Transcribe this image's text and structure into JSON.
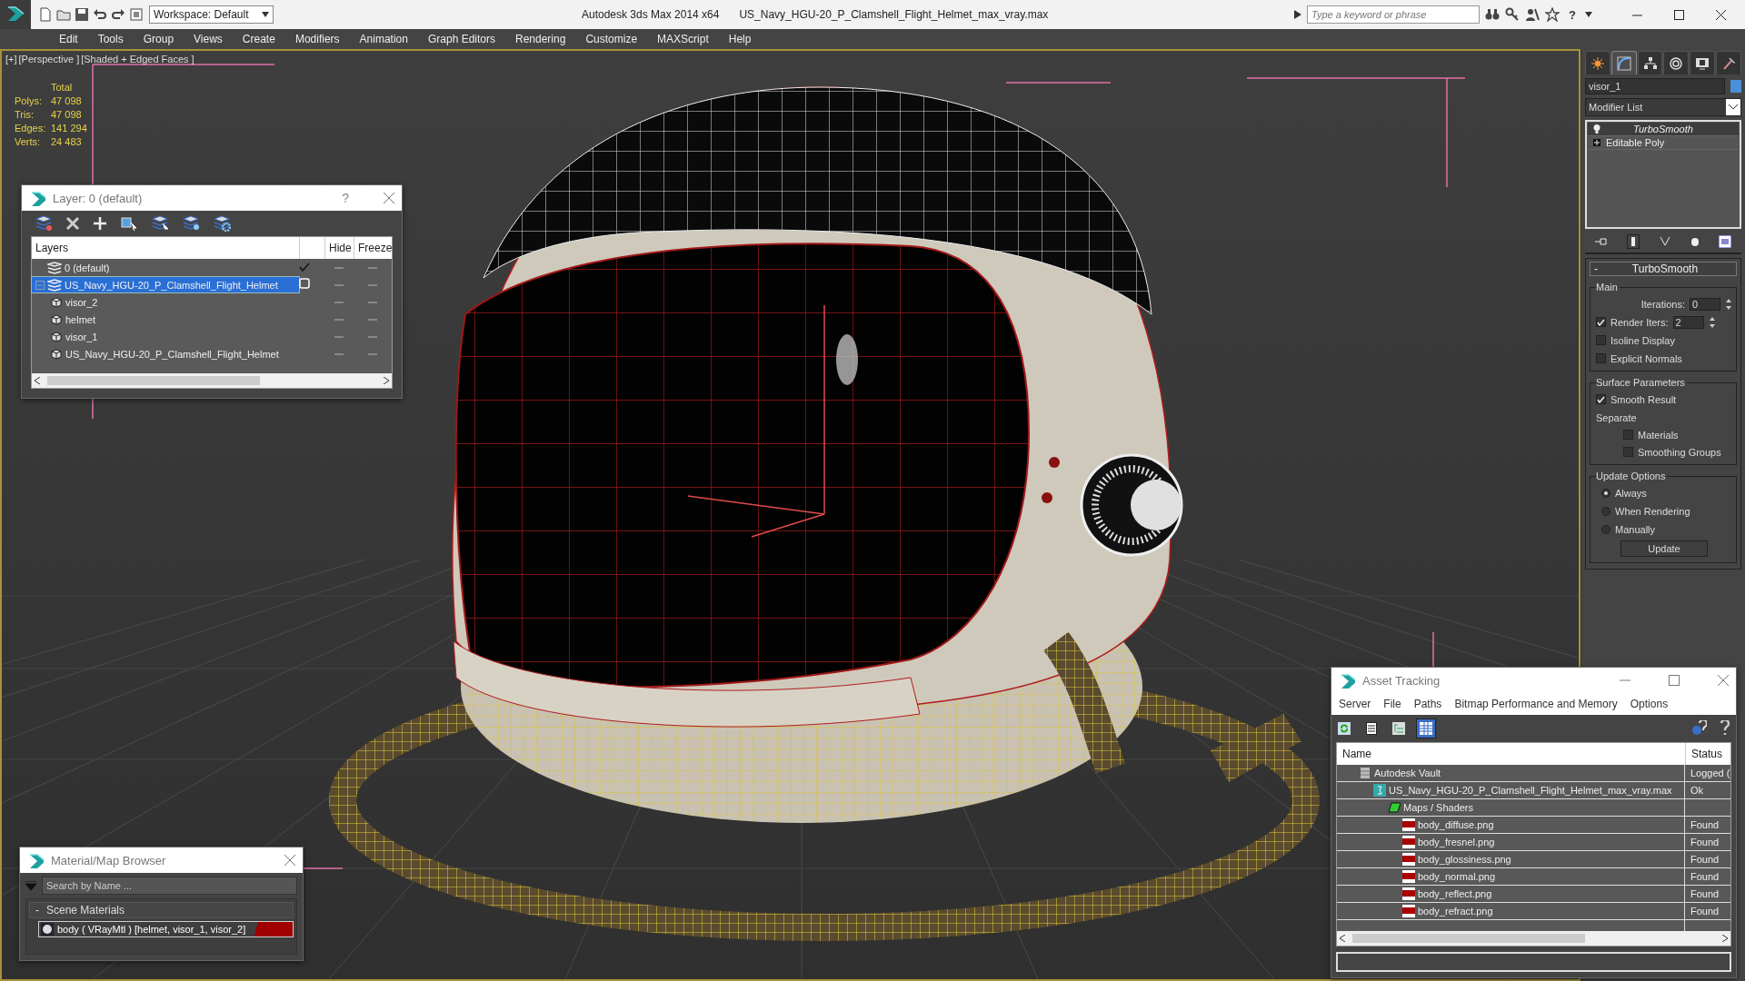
{
  "title_bar": {
    "workspace": "Workspace: Default",
    "app_title": "Autodesk 3ds Max  2014 x64",
    "file_name": "US_Navy_HGU-20_P_Clamshell_Flight_Helmet_max_vray.max",
    "search": {
      "placeholder": "Type a keyword or phrase"
    },
    "help": "?"
  },
  "menu": [
    "Edit",
    "Tools",
    "Group",
    "Views",
    "Create",
    "Modifiers",
    "Animation",
    "Graph Editors",
    "Rendering",
    "Customize",
    "MAXScript",
    "Help"
  ],
  "viewport": {
    "label": [
      "[+]",
      "[Perspective ]",
      "[Shaded + Edged Faces ]"
    ],
    "stats": {
      "header": "Total",
      "rows": [
        {
          "label": "Polys:",
          "value": "47 098"
        },
        {
          "label": "Tris:",
          "value": "47 098"
        },
        {
          "label": "Edges:",
          "value": "141 294"
        },
        {
          "label": "Verts:",
          "value": "24 483"
        }
      ]
    }
  },
  "layer_dialog": {
    "title": "Layer: 0 (default)",
    "help": "?",
    "columns": [
      "Layers",
      "Hide",
      "Freeze"
    ],
    "rows": [
      {
        "name": "0 (default)",
        "kind": "layer",
        "selected": false,
        "current": true
      },
      {
        "name": "US_Navy_HGU-20_P_Clamshell_Flight_Helmet",
        "kind": "layer",
        "selected": true,
        "current": false,
        "expanded": true,
        "children": [
          {
            "name": "visor_2",
            "kind": "object",
            "selected": false
          },
          {
            "name": "helmet",
            "kind": "object",
            "selected": false
          },
          {
            "name": "visor_1",
            "kind": "object",
            "selected": false
          },
          {
            "name": "US_Navy_HGU-20_P_Clamshell_Flight_Helmet",
            "kind": "object",
            "selected": false
          }
        ]
      }
    ]
  },
  "material_browser": {
    "title": "Material/Map Browser",
    "search": {
      "placeholder": "Search by Name ..."
    },
    "group": {
      "toggle": "-",
      "label": "Scene Materials"
    },
    "items": [
      {
        "name": "body  ( VRayMtl ) [helmet, visor_1, visor_2]",
        "selected": true
      }
    ]
  },
  "command_panel": {
    "tabs": [
      {
        "selected": false
      },
      {
        "selected": true
      },
      {
        "selected": false
      },
      {
        "selected": false
      },
      {
        "selected": false
      },
      {
        "selected": false
      }
    ],
    "object_name": "visor_1",
    "modifier_list": "Modifier List",
    "stack": [
      {
        "name": "TurboSmooth",
        "kind": "modifier",
        "selected": true
      },
      {
        "name": "Editable Poly",
        "kind": "base",
        "selected": false
      }
    ],
    "rollout": {
      "toggle": "-",
      "title": "TurboSmooth",
      "groups": [
        {
          "title": "Main",
          "controls": [
            {
              "kind": "spinner",
              "label": "Iterations:",
              "value": "0"
            },
            {
              "kind": "check_spinner",
              "label": "Render Iters:",
              "value": "2",
              "checked": true
            },
            {
              "kind": "checkbox",
              "label": "Isoline Display",
              "checked": false
            },
            {
              "kind": "checkbox",
              "label": "Explicit Normals",
              "checked": false
            }
          ]
        },
        {
          "title": "Surface Parameters",
          "controls": [
            {
              "kind": "checkbox",
              "label": "Smooth Result",
              "checked": true
            },
            {
              "kind": "label",
              "label": "Separate",
              "children": [
                {
                  "kind": "checkbox",
                  "label": "Materials",
                  "checked": false
                },
                {
                  "kind": "checkbox",
                  "label": "Smoothing Groups",
                  "checked": false
                }
              ]
            }
          ]
        },
        {
          "title": "Update Options",
          "controls": [
            {
              "kind": "radio",
              "label": "Always",
              "selected": true
            },
            {
              "kind": "radio",
              "label": "When Rendering",
              "selected": false
            },
            {
              "kind": "radio",
              "label": "Manually",
              "selected": false
            },
            {
              "kind": "button",
              "label": "Update"
            }
          ]
        }
      ]
    }
  },
  "asset_tracking": {
    "title": "Asset Tracking",
    "menu": [
      "Server",
      "File",
      "Paths",
      "Bitmap Performance and Memory",
      "Options"
    ],
    "columns": [
      "Name",
      "Status"
    ],
    "rows": [
      {
        "name": "Autodesk Vault",
        "kind": "vault",
        "status": "Logged (",
        "children": [
          {
            "name": "US_Navy_HGU-20_P_Clamshell_Flight_Helmet_max_vray.max",
            "kind": "scene",
            "status": "Ok",
            "children": [
              {
                "name": "Maps / Shaders",
                "kind": "folder",
                "children": [
                  {
                    "name": "body_diffuse.png",
                    "kind": "png",
                    "status": "Found"
                  },
                  {
                    "name": "body_fresnel.png",
                    "kind": "png",
                    "status": "Found"
                  },
                  {
                    "name": "body_glossiness.png",
                    "kind": "png",
                    "status": "Found"
                  },
                  {
                    "name": "body_normal.png",
                    "kind": "png",
                    "status": "Found"
                  },
                  {
                    "name": "body_reflect.png",
                    "kind": "png",
                    "status": "Found"
                  },
                  {
                    "name": "body_refract.png",
                    "kind": "png",
                    "status": "Found"
                  }
                ]
              }
            ]
          }
        ]
      }
    ]
  }
}
